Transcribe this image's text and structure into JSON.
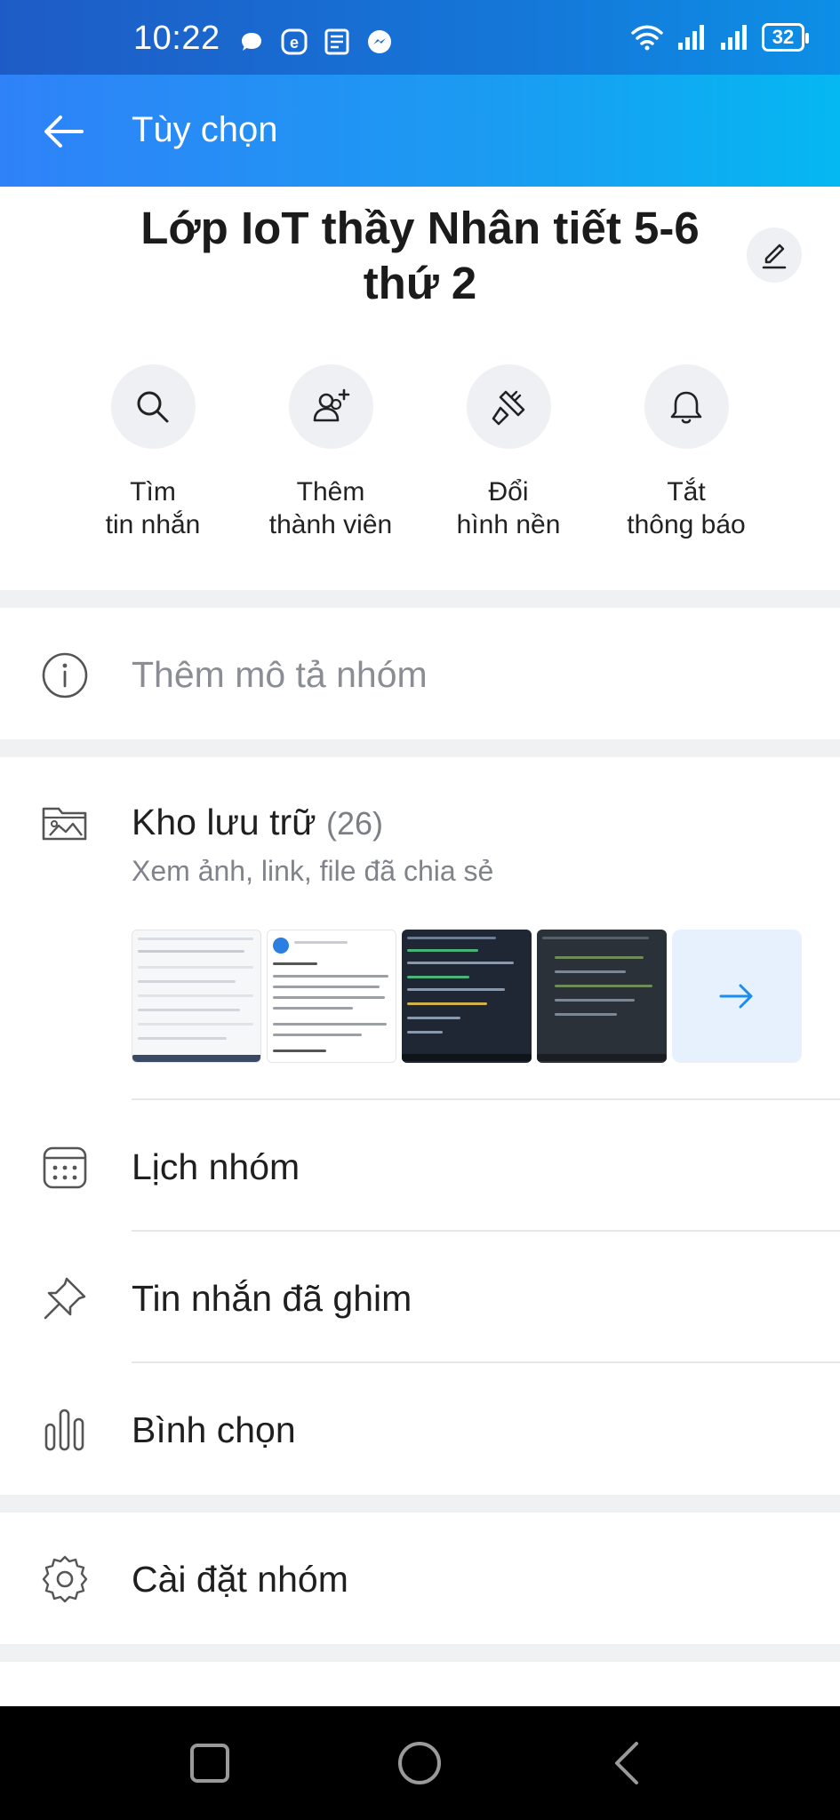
{
  "status_bar": {
    "time": "10:22",
    "battery": "32",
    "notification_icons": [
      "chat-bubble-icon",
      "e-app-icon",
      "document-icon",
      "messenger-icon"
    ],
    "system_icons": [
      "wifi-icon",
      "signal-icon",
      "signal-icon"
    ]
  },
  "app_bar": {
    "title": "Tùy chọn",
    "back_icon": "arrow-left-icon"
  },
  "group": {
    "name": "Lớp IoT thầy Nhân tiết 5-6 thứ 2",
    "edit_icon": "pencil-icon"
  },
  "quick_actions": [
    {
      "label_line1": "Tìm",
      "label_line2": "tin nhắn",
      "icon": "search-icon"
    },
    {
      "label_line1": "Thêm",
      "label_line2": "thành viên",
      "icon": "add-member-icon"
    },
    {
      "label_line1": "Đổi",
      "label_line2": "hình nền",
      "icon": "paintbrush-icon"
    },
    {
      "label_line1": "Tắt",
      "label_line2": "thông báo",
      "icon": "bell-icon"
    }
  ],
  "description": {
    "placeholder": "Thêm mô tả nhóm",
    "icon": "info-icon"
  },
  "storage": {
    "title": "Kho lưu trữ",
    "count": "(26)",
    "subtitle": "Xem ảnh, link, file đã chia sẻ",
    "icon": "folder-image-icon",
    "more_icon": "arrow-right-icon"
  },
  "menu": [
    {
      "label": "Lịch nhóm",
      "icon": "calendar-icon"
    },
    {
      "label": "Tin nhắn đã ghim",
      "icon": "pin-icon"
    },
    {
      "label": "Bình chọn",
      "icon": "poll-icon"
    }
  ],
  "settings": {
    "label": "Cài đặt nhóm",
    "icon": "gear-icon"
  },
  "colors": {
    "accent": "#1a8ef0",
    "appbar_start": "#2f82f8",
    "appbar_end": "#05b8f2"
  }
}
